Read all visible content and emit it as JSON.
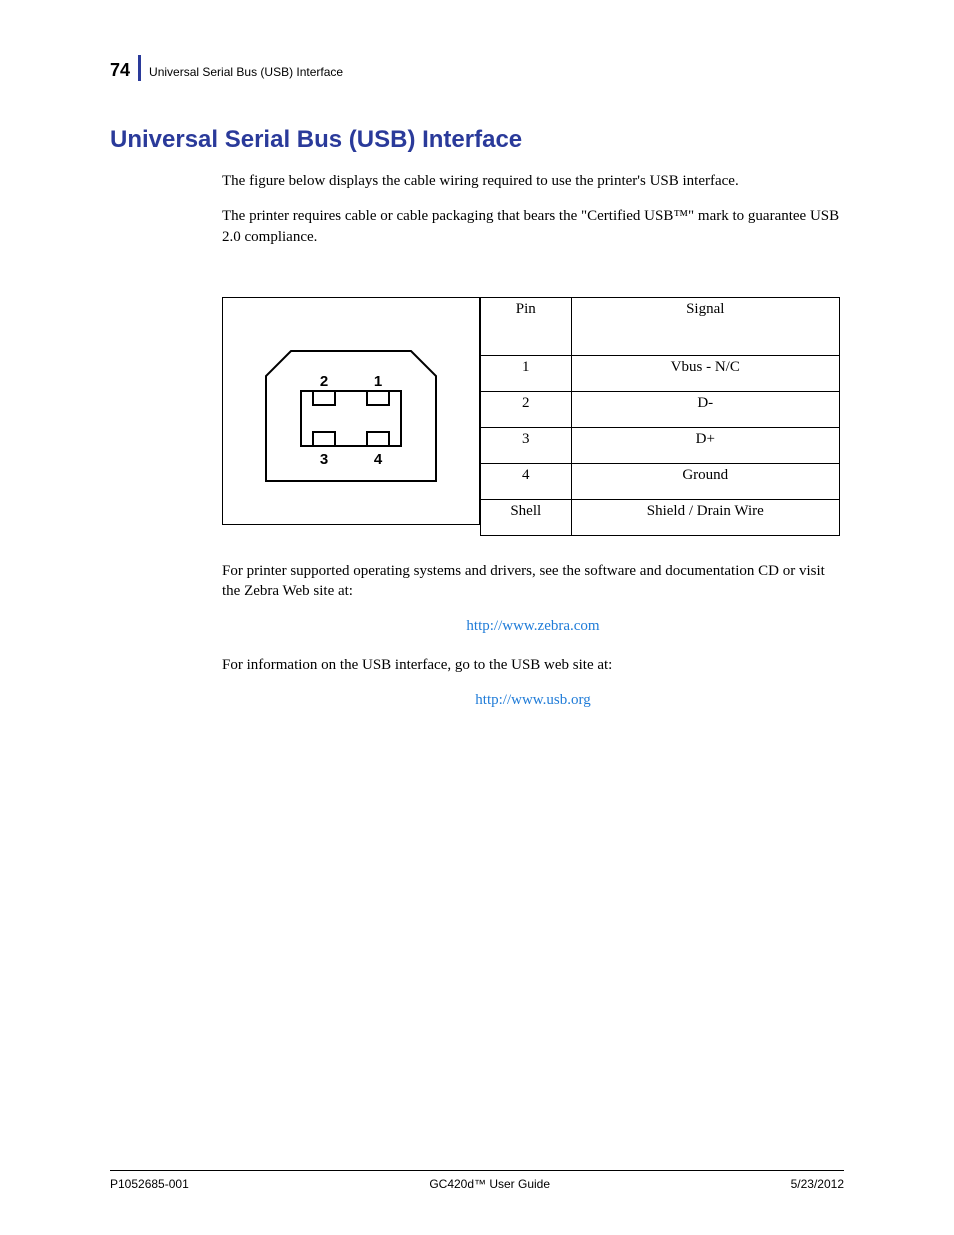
{
  "header": {
    "page_number": "74",
    "running_title": "Universal Serial Bus (USB) Interface"
  },
  "title": "Universal Serial Bus (USB) Interface",
  "paragraphs": {
    "p1": "The figure below displays the cable wiring required to use the printer's USB interface.",
    "p2": "The printer requires cable or cable packaging that bears the \"Certified USB™\" mark to guarantee USB 2.0 compliance.",
    "p3": "For printer supported operating systems and drivers, see the software and documentation CD or visit the Zebra Web site at:",
    "p4": "For information on the USB interface, go to the USB web site at:"
  },
  "links": {
    "zebra": "http://www.zebra.com",
    "usb": "http://www.usb.org"
  },
  "connector": {
    "labels": {
      "tl": "2",
      "tr": "1",
      "bl": "3",
      "br": "4"
    }
  },
  "table": {
    "headers": {
      "pin": "Pin",
      "signal": "Signal"
    },
    "rows": [
      {
        "pin": "1",
        "signal": "Vbus - N/C"
      },
      {
        "pin": "2",
        "signal": "D-"
      },
      {
        "pin": "3",
        "signal": "D+"
      },
      {
        "pin": "4",
        "signal": "Ground"
      },
      {
        "pin": "Shell",
        "signal": "Shield / Drain Wire"
      }
    ]
  },
  "footer": {
    "left": "P1052685-001",
    "center": "GC420d™ User Guide",
    "right": "5/23/2012"
  }
}
